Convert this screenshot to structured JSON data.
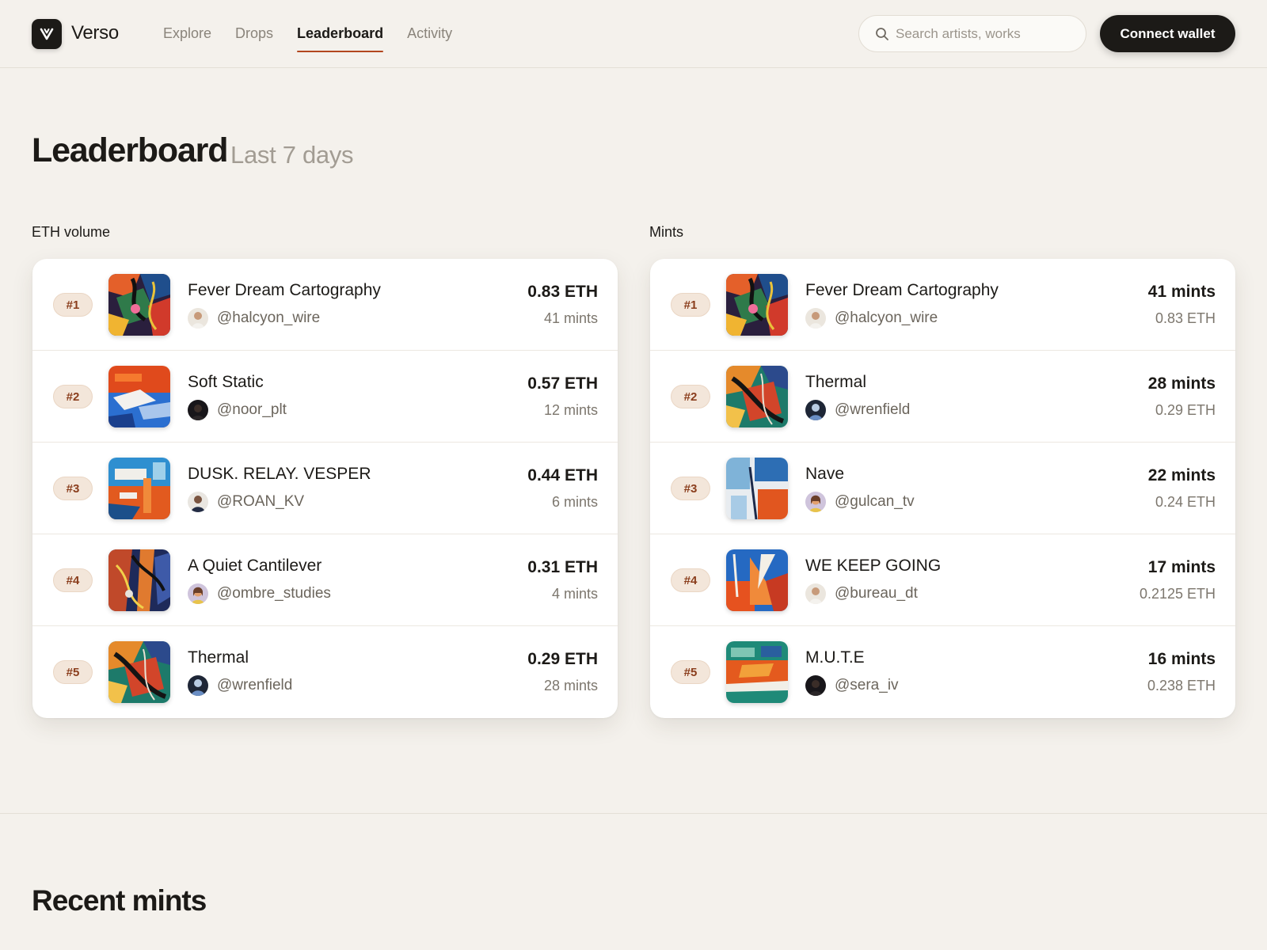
{
  "app": {
    "name": "Verso"
  },
  "nav": [
    {
      "label": "Explore",
      "active": false
    },
    {
      "label": "Drops",
      "active": false
    },
    {
      "label": "Leaderboard",
      "active": true
    },
    {
      "label": "Activity",
      "active": false
    }
  ],
  "search": {
    "placeholder": "Search artists, works",
    "value": ""
  },
  "header": {
    "connect_label": "Connect wallet"
  },
  "page": {
    "title": "Leaderboard",
    "subtitle": "Last 7 days"
  },
  "colors": {
    "accent": "#b2461f",
    "background": "#f4f1ec",
    "ink": "#1c1a17",
    "rank_badge": "#f3e6da"
  },
  "eth_volume": {
    "label": "ETH volume",
    "rows": [
      {
        "rank": "#1",
        "title": "Fever Dream Cartography",
        "artist": "@halcyon_wire",
        "primary": "0.83 ETH",
        "secondary": "41 mints",
        "art": "fever",
        "avatar": "light"
      },
      {
        "rank": "#2",
        "title": "Soft Static",
        "artist": "@noor_plt",
        "primary": "0.57 ETH",
        "secondary": "12 mints",
        "art": "static",
        "avatar": "dark"
      },
      {
        "rank": "#3",
        "title": "DUSK. RELAY. VESPER",
        "artist": "@ROAN_KV",
        "primary": "0.44 ETH",
        "secondary": "6 mints",
        "art": "dusk",
        "avatar": "suit"
      },
      {
        "rank": "#4",
        "title": "A Quiet Cantilever",
        "artist": "@ombre_studies",
        "primary": "0.31 ETH",
        "secondary": "4 mints",
        "art": "cantilever",
        "avatar": "warm"
      },
      {
        "rank": "#5",
        "title": "Thermal",
        "artist": "@wrenfield",
        "primary": "0.29 ETH",
        "secondary": "28 mints",
        "art": "thermal",
        "avatar": "blue"
      }
    ]
  },
  "mints": {
    "label": "Mints",
    "rows": [
      {
        "rank": "#1",
        "title": "Fever Dream Cartography",
        "artist": "@halcyon_wire",
        "primary": "41 mints",
        "secondary": "0.83 ETH",
        "art": "fever",
        "avatar": "light"
      },
      {
        "rank": "#2",
        "title": "Thermal",
        "artist": "@wrenfield",
        "primary": "28 mints",
        "secondary": "0.29 ETH",
        "art": "thermal",
        "avatar": "blue"
      },
      {
        "rank": "#3",
        "title": "Nave",
        "artist": "@gulcan_tv",
        "primary": "22 mints",
        "secondary": "0.24 ETH",
        "art": "nave",
        "avatar": "warm"
      },
      {
        "rank": "#4",
        "title": "WE KEEP GOING",
        "artist": "@bureau_dt",
        "primary": "17 mints",
        "secondary": "0.2125 ETH",
        "art": "keepgoing",
        "avatar": "light"
      },
      {
        "rank": "#5",
        "title": "M.U.T.E",
        "artist": "@sera_iv",
        "primary": "16 mints",
        "secondary": "0.238 ETH",
        "art": "mute",
        "avatar": "dark"
      }
    ]
  },
  "recent": {
    "title": "Recent mints"
  }
}
